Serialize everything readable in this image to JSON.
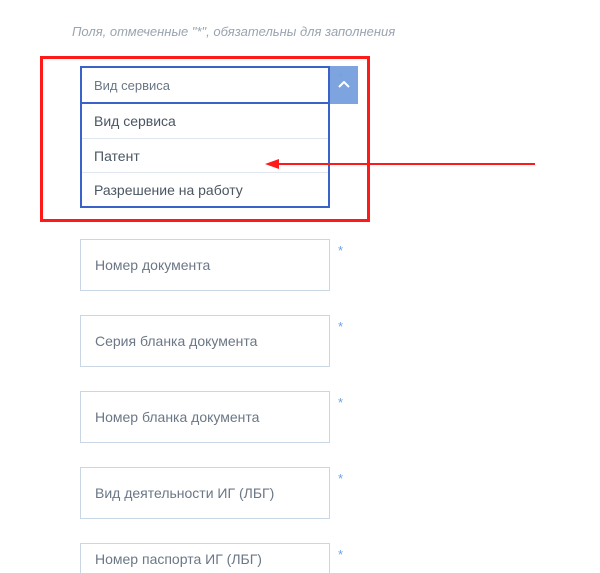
{
  "helper_text": "Поля, отмеченные \"*\", обязательны для заполнения",
  "dropdown": {
    "label": "Вид сервиса",
    "options": [
      "Вид сервиса",
      "Патент",
      "Разрешение на работу"
    ]
  },
  "fields": [
    {
      "label": "Номер документа"
    },
    {
      "label": "Серия бланка документа"
    },
    {
      "label": "Номер бланка документа"
    },
    {
      "label": "Вид деятельности ИГ (ЛБГ)"
    },
    {
      "label": "Номер паспорта ИГ (ЛБГ)"
    }
  ],
  "required_mark": "*",
  "annotation_color": "#ff1a1a"
}
